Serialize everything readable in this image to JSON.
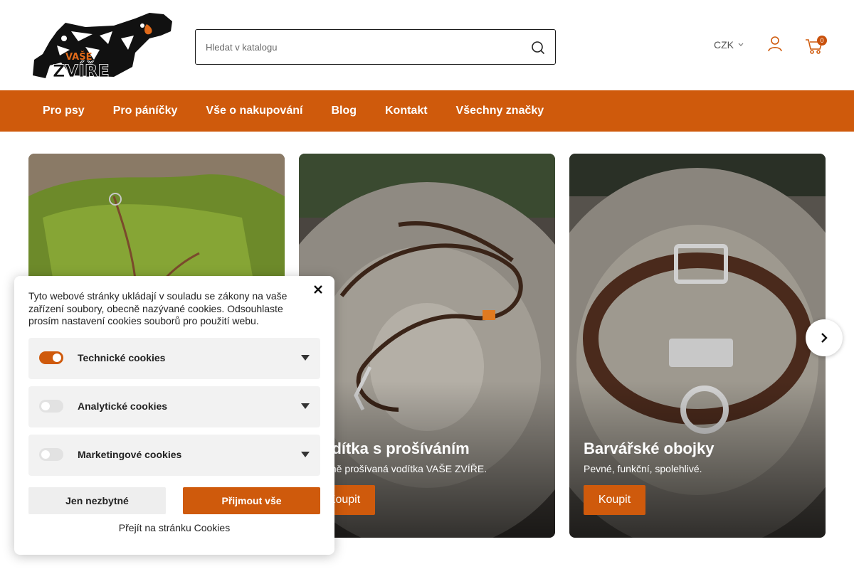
{
  "header": {
    "search_placeholder": "Hledat v katalogu",
    "currency": "CZK",
    "cart_count": "0",
    "logo_text": "VAŠE ZVÍŘE"
  },
  "nav": {
    "items": [
      "Pro psy",
      "Pro páníčky",
      "Vše o nakupování",
      "Blog",
      "Kontakt",
      "Všechny značky"
    ]
  },
  "slides": [
    {
      "title": "",
      "subtitle": "",
      "button": ""
    },
    {
      "title": "Vodítka s prošíváním",
      "subtitle": "Ručně prošívaná vodítka VAŠE ZVÍŘE.",
      "button": "Koupit"
    },
    {
      "title": "Barvářské obojky",
      "subtitle": "Pevné, funkční, spolehlivé.",
      "button": "Koupit"
    }
  ],
  "cookie": {
    "intro": "Tyto webové stránky ukládají v souladu se zákony na vaše zařízení soubory, obecně nazývané cookies. Odsouhlaste prosím nastavení cookies souborů pro použití webu.",
    "options": [
      {
        "label": "Technické cookies",
        "enabled": true
      },
      {
        "label": "Analytické cookies",
        "enabled": false
      },
      {
        "label": "Marketingové cookies",
        "enabled": false
      }
    ],
    "essential_button": "Jen nezbytné",
    "accept_button": "Přijmout vše",
    "link": "Přejít na stránku Cookies"
  },
  "colors": {
    "accent": "#cf5a0c"
  }
}
